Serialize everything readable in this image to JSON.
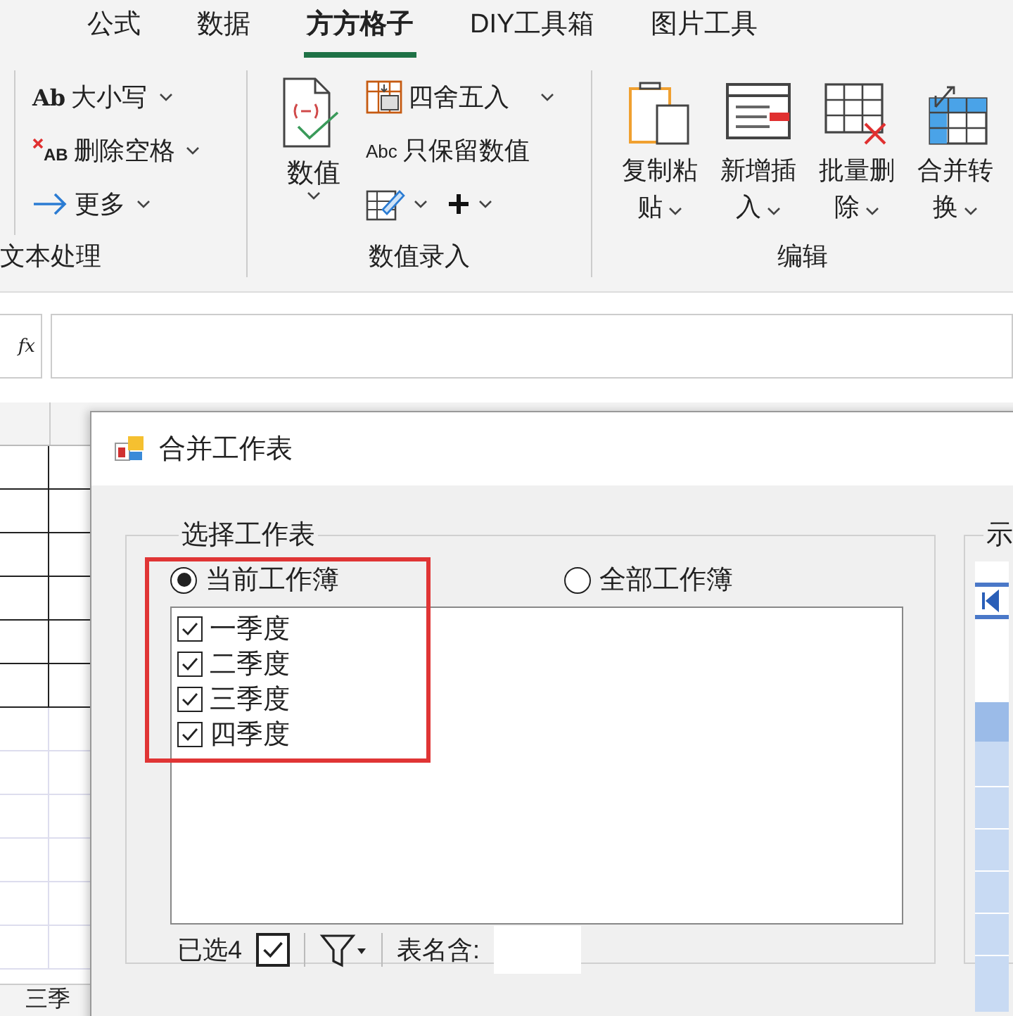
{
  "ribbon": {
    "tabs": [
      {
        "label": "公式",
        "selected": false
      },
      {
        "label": "数据",
        "selected": false
      },
      {
        "label": "方方格子",
        "selected": true
      },
      {
        "label": "DIY工具箱",
        "selected": false
      },
      {
        "label": "图片工具",
        "selected": false
      }
    ],
    "groups": [
      {
        "label": "文本处理",
        "small_buttons": [
          {
            "icon_text": "Ab",
            "label": "大小写",
            "dropdown": true
          },
          {
            "icon_text": "AB",
            "label": "删除空格",
            "dropdown": true
          },
          {
            "label": "更多",
            "dropdown": true
          }
        ]
      },
      {
        "label": "数值录入",
        "large_buttons": [
          {
            "label": "数值",
            "dropdown": true
          }
        ],
        "small_buttons": [
          {
            "label": "四舍五入",
            "dropdown": true
          },
          {
            "icon_text": "Abc",
            "label": "只保留数值",
            "dropdown": false
          }
        ],
        "icon_buttons": [
          {
            "dropdown": true
          },
          {
            "dropdown": true
          }
        ]
      },
      {
        "label": "编辑",
        "large_buttons": [
          {
            "label": "复制粘贴",
            "dropdown": true
          },
          {
            "label": "新增插入",
            "dropdown": true
          },
          {
            "label": "批量删除",
            "dropdown": true
          },
          {
            "label": "合并转换",
            "dropdown": true
          }
        ]
      }
    ]
  },
  "formula_bar": {
    "function_label": "fx"
  },
  "sheet_tabs": [
    {
      "label": "三季"
    }
  ],
  "dialog": {
    "title": "合并工作表",
    "sheet_group": {
      "title": "选择工作表",
      "scopes": [
        {
          "label": "当前工作簿",
          "selected": true
        },
        {
          "label": "全部工作簿",
          "selected": false
        }
      ],
      "sheets": [
        {
          "name": "一季度",
          "checked": true
        },
        {
          "name": "二季度",
          "checked": true
        },
        {
          "name": "三季度",
          "checked": true
        },
        {
          "name": "四季度",
          "checked": true
        }
      ],
      "selected_count": "已选4",
      "select_all_checked": true,
      "name_filter_label": "表名含:"
    },
    "preview_group": {
      "title": "示"
    }
  }
}
